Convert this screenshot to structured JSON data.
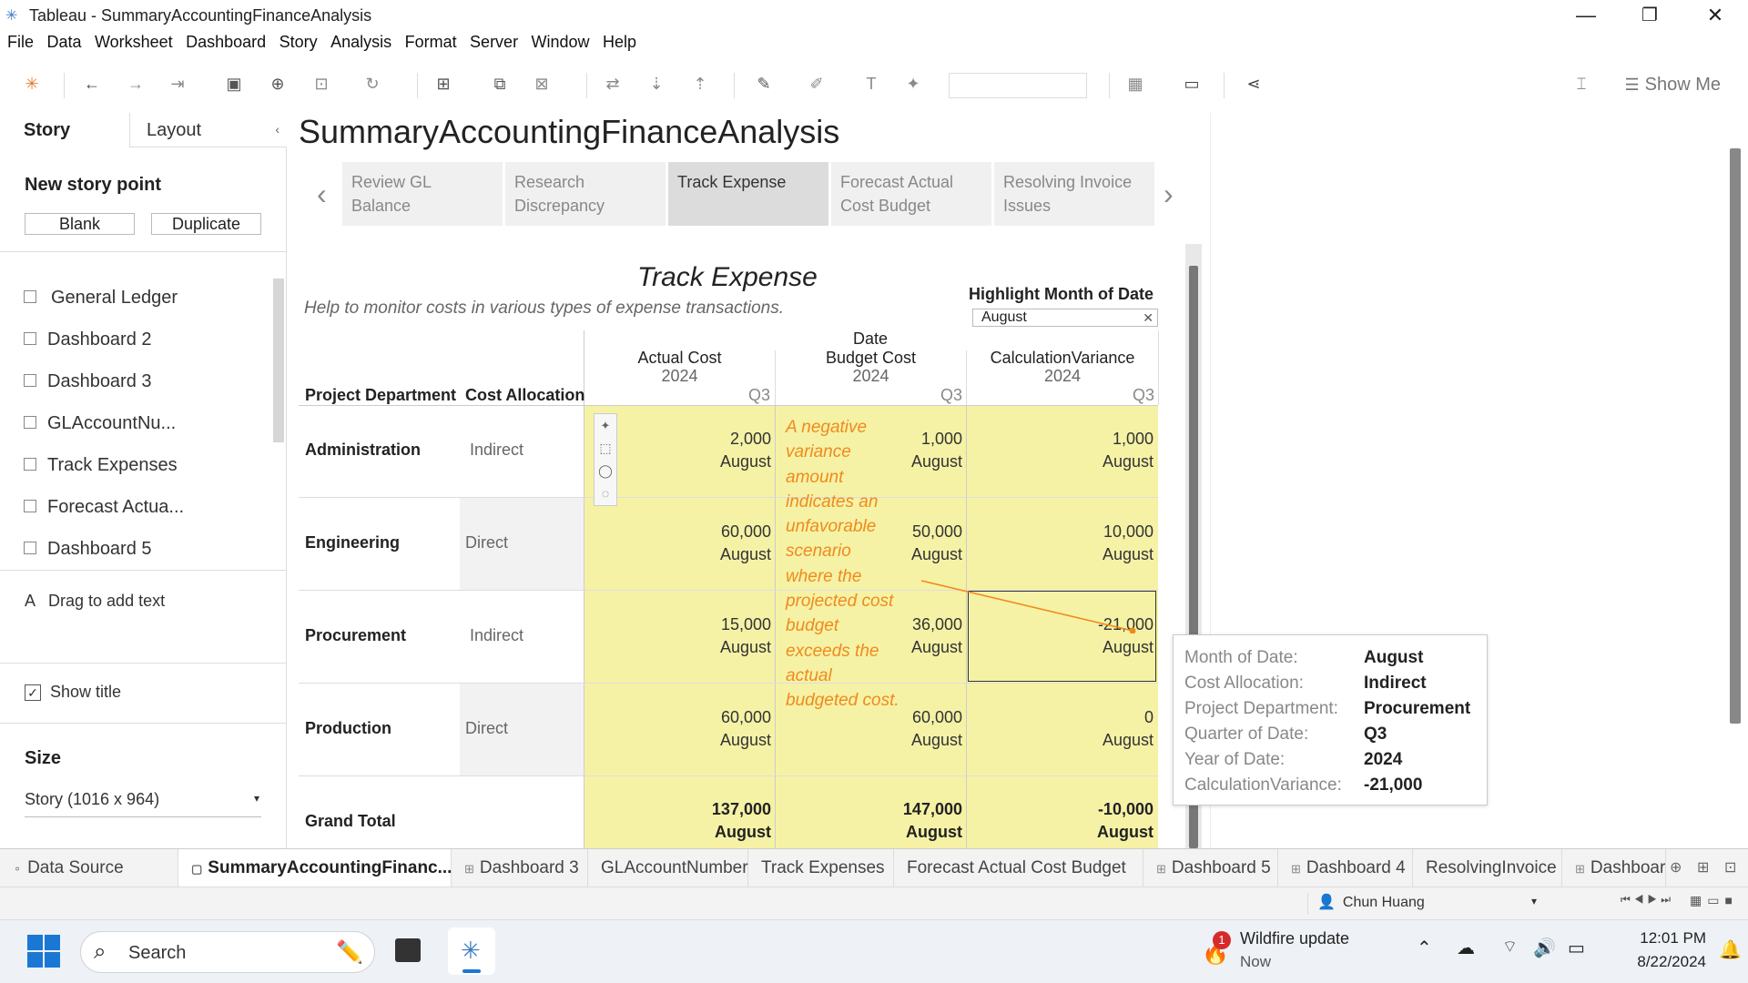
{
  "window": {
    "title": "Tableau - SummaryAccountingFinanceAnalysis",
    "minimize": "—",
    "restore": "❐",
    "close": "✕"
  },
  "menu": [
    "File",
    "Data",
    "Worksheet",
    "Dashboard",
    "Story",
    "Analysis",
    "Format",
    "Server",
    "Window",
    "Help"
  ],
  "toolbar": {
    "show_me": "Show Me"
  },
  "left_panel": {
    "tabs": {
      "story": "Story",
      "layout": "Layout"
    },
    "new_story_point": "New story point",
    "blank": "Blank",
    "duplicate": "Duplicate",
    "sheets": [
      "General Ledger",
      "Dashboard 2",
      "Dashboard 3",
      "GLAccountNu...",
      "Track Expenses",
      "Forecast Actua...",
      "Dashboard 5"
    ],
    "drag_text": "Drag to add text",
    "show_title": "Show title",
    "size_label": "Size",
    "size_value": "Story (1016 x 964)"
  },
  "story": {
    "title": "SummaryAccountingFinanceAnalysis",
    "points": [
      {
        "line1": "Review GL",
        "line2": "Balance"
      },
      {
        "line1": "Research",
        "line2": "Discrepancy"
      },
      {
        "line1": "Track Expense",
        "line2": ""
      },
      {
        "line1": "Forecast Actual",
        "line2": "Cost Budget"
      },
      {
        "line1": "Resolving Invoice",
        "line2": "Issues"
      }
    ]
  },
  "dashboard": {
    "title": "Track Expense",
    "subtitle": "Help to  monitor costs in various types of expense transactions.",
    "highlight_label": "Highlight Month of Date",
    "highlight_value": "August",
    "col_group": "Date",
    "row_headers": {
      "dept": "Project Department",
      "alloc": "Cost Allocation"
    },
    "columns": [
      {
        "name": "Actual Cost",
        "year": "2024",
        "quarter": "Q3"
      },
      {
        "name": "Budget Cost",
        "year": "2024",
        "quarter": "Q3"
      },
      {
        "name": "CalculationVariance",
        "year": "2024",
        "quarter": "Q3"
      }
    ],
    "rows": [
      {
        "dept": "Administration",
        "alloc": "Indirect",
        "actual": "2,000",
        "budget": "1,000",
        "variance": "1,000",
        "month": "August"
      },
      {
        "dept": "Engineering",
        "alloc": "Direct",
        "actual": "60,000",
        "budget": "50,000",
        "variance": "10,000",
        "month": "August"
      },
      {
        "dept": "Procurement",
        "alloc": "Indirect",
        "actual": "15,000",
        "budget": "36,000",
        "variance": "-21,000",
        "month": "August"
      },
      {
        "dept": "Production",
        "alloc": "Direct",
        "actual": "60,000",
        "budget": "60,000",
        "variance": "0",
        "month": "August"
      }
    ],
    "grand_total": {
      "label": "Grand Total",
      "actual": "137,000",
      "budget": "147,000",
      "variance": "-10,000",
      "month": "August"
    },
    "annotation": "A negative variance amount indicates an unfavorable scenario where the projected cost budget exceeds the actual budgeted cost."
  },
  "tooltip": [
    {
      "k": "Month of Date:",
      "v": "August"
    },
    {
      "k": "Cost Allocation:",
      "v": " Indirect"
    },
    {
      "k": "Project Department:",
      "v": "Procurement"
    },
    {
      "k": "Quarter of Date:",
      "v": "Q3"
    },
    {
      "k": "Year of Date:",
      "v": "2024"
    },
    {
      "k": "CalculationVariance:",
      "v": "-21,000"
    }
  ],
  "sheet_tabs": [
    "Data Source",
    "SummaryAccountingFinanc...",
    "Dashboard 3",
    "GLAccountNumber",
    "Track Expenses",
    "Forecast Actual Cost Budget",
    "Dashboard 5",
    "Dashboard 4",
    "ResolvingInvoice",
    "Dashboard"
  ],
  "status": {
    "user": "Chun Huang"
  },
  "taskbar": {
    "search": "Search",
    "notification_title": "Wildfire update",
    "notification_sub": "Now",
    "notification_badge": "1",
    "time": "12:01 PM",
    "date": "8/22/2024"
  },
  "colors": {
    "highlight": "#f5f2a6",
    "annotation": "#f08a1c",
    "accent": "#3b7ec0"
  }
}
